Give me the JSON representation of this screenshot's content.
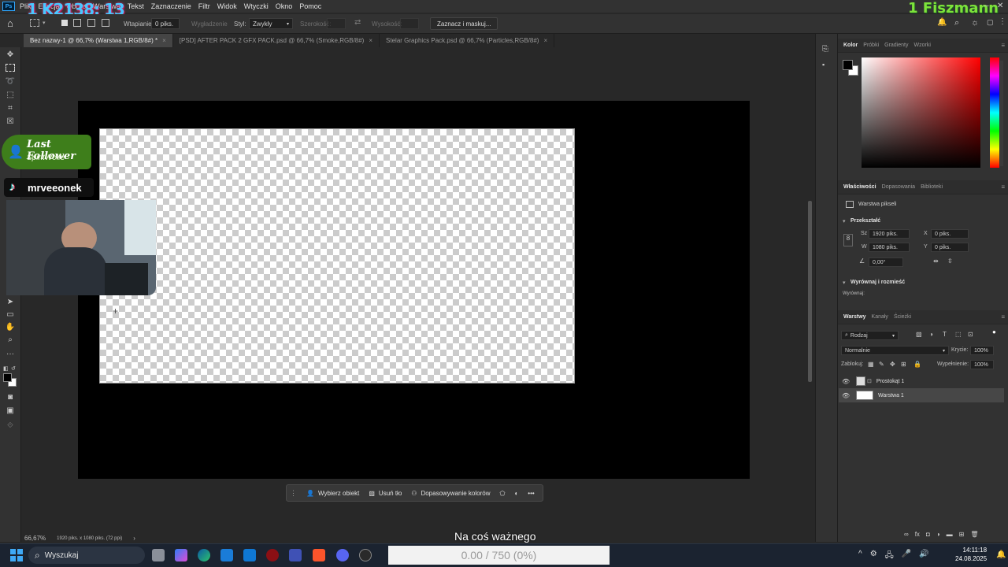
{
  "overlay": {
    "left_tag": "1 K2138: 13",
    "right_tag": "1 Fiszmann"
  },
  "menu": [
    "Plik",
    "Edycja",
    "Obraz",
    "Warstwa",
    "Tekst",
    "Zaznaczenie",
    "Filtr",
    "Widok",
    "Wtyczki",
    "Okno",
    "Pomoc"
  ],
  "options": {
    "feather_label": "Wtapianie:",
    "feather_value": "0 piks.",
    "smoothing_label": "Wygładzenie",
    "style_label": "Styl:",
    "style_value": "Zwykły",
    "width_label": "Szerokość:",
    "height_label": "Wysokość:",
    "select_mask_button": "Zaznacz i maskuj..."
  },
  "tabs": [
    {
      "label": "Bez nazwy-1 @ 66,7% (Warstwa 1,RGB/8#) *",
      "active": true
    },
    {
      "label": "[PSD] AFTER PACK 2 GFX PACK.psd @ 66,7% (Smoke,RGB/8#)",
      "active": false
    },
    {
      "label": "Stelar Graphics Pack.psd @ 66,7% (Particles,RGB/8#)",
      "active": false
    }
  ],
  "stream": {
    "follower_title": "Last Follower",
    "follower_name": "SpiritWolfe",
    "tiktok_handle": "mrveeonek"
  },
  "context_bar": {
    "select_subject": "Wybierz obiekt",
    "remove_bg": "Usuń tło",
    "color_match": "Dopasowywanie kolorów",
    "more": "•••"
  },
  "status": {
    "zoom": "66,67%",
    "doc_info": "1920 piks. x 1080 piks. (72 ppi)",
    "arrow": "›"
  },
  "subtitle": "Na coś ważnego",
  "panels": {
    "color_tabs": [
      "Kolor",
      "Próbki",
      "Gradienty",
      "Wzorki"
    ],
    "props_tabs": [
      "Właściwości",
      "Dopasowania",
      "Biblioteki"
    ],
    "pixel_layer": "Warstwa pikseli",
    "transform_header": "Przekształć",
    "w_label": "Sz",
    "w_value": "1920 piks.",
    "h_label": "W",
    "h_value": "1080 piks.",
    "x_label": "X",
    "x_value": "0 piks.",
    "y_label": "Y",
    "y_value": "0 piks.",
    "angle_value": "0,00°",
    "align_header": "Wyrównaj i rozmieść",
    "align_label": "Wyrównaj:",
    "layers_tabs": [
      "Warstwy",
      "Kanały",
      "Ścieżki"
    ],
    "filter_kind": "Rodzaj",
    "blend_mode": "Normalnie",
    "opacity_label": "Krycie:",
    "opacity_value": "100%",
    "lock_label": "Zablokuj:",
    "fill_label": "Wypełnienie:",
    "fill_value": "100%",
    "layers": [
      {
        "name": "Prostokąt 1",
        "selected": false
      },
      {
        "name": "Warstwa 1",
        "selected": true
      }
    ]
  },
  "taskbar": {
    "search": "Wyszukaj",
    "progress": "0.00 / 750 (0%)",
    "time": "14:11:18",
    "date": "24.08.2025"
  },
  "colors": {
    "accent_ps": "#31a8ff",
    "follower_green": "#3e7e1b",
    "taskbar": "#1b2330"
  }
}
